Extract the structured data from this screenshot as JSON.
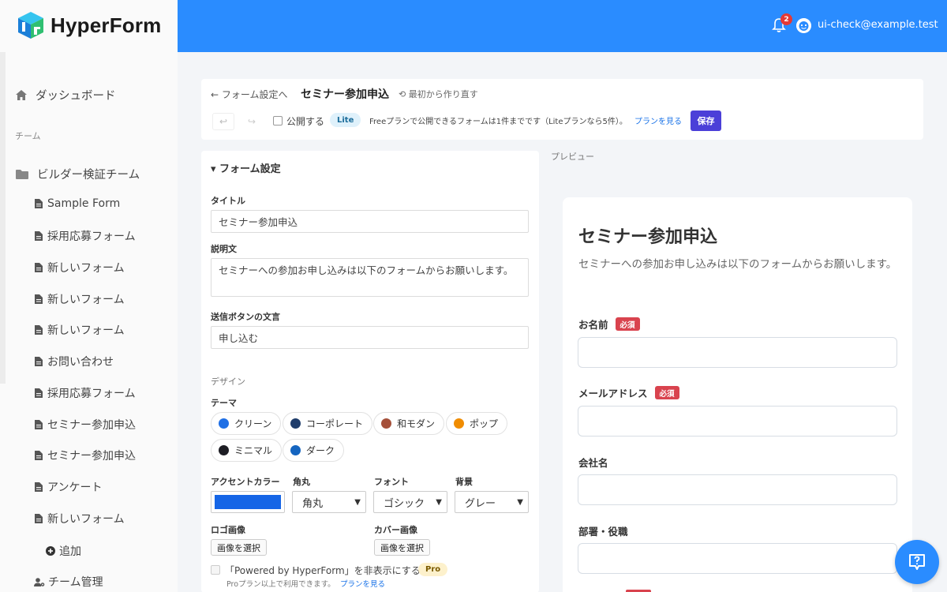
{
  "brand": {
    "name": "HyperForm"
  },
  "header": {
    "notification_count": "2",
    "user_email": "ui-check@example.test"
  },
  "sidebar": {
    "dashboard": "ダッシュボード",
    "team_section": "チーム",
    "team_name": "ビルダー検証チーム",
    "forms": [
      "Sample Form",
      "採用応募フォーム",
      "新しいフォーム",
      "新しいフォーム",
      "新しいフォーム",
      "お問い合わせ",
      "採用応募フォーム",
      "セミナー参加申込",
      "セミナー参加申込",
      "アンケート",
      "新しいフォーム"
    ],
    "add": "追加",
    "team_manage": "チーム管理"
  },
  "toolbar": {
    "back": "← フォーム設定へ",
    "title": "セミナー参加申込",
    "restart": "⟲ 最初から作り直す",
    "undo": "↩",
    "redo": "↪",
    "publish_label": "公開する",
    "plan_badge": "Lite",
    "plan_note": "Freeプランで公開できるフォームは1件までです（Liteプランなら5件）。",
    "plan_link": "プランを見る",
    "save": "保存"
  },
  "settings": {
    "heading": "▾ フォーム設定",
    "title_label": "タイトル",
    "title_value": "セミナー参加申込",
    "desc_label": "説明文",
    "desc_value": "セミナーへの参加お申し込みは以下のフォームからお願いします。",
    "submit_label": "送信ボタンの文言",
    "submit_value": "申し込む",
    "design_label": "デザイン",
    "theme_label": "テーマ",
    "themes": [
      {
        "name": "クリーン",
        "color": "#1f6fe5"
      },
      {
        "name": "コーポレート",
        "color": "#1f3d6b"
      },
      {
        "name": "和モダン",
        "color": "#a5503a"
      },
      {
        "name": "ポップ",
        "color": "#f08c00"
      },
      {
        "name": "ミニマル",
        "color": "#1d1d24"
      },
      {
        "name": "ダーク",
        "color": "#1565c0"
      }
    ],
    "accent_label": "アクセントカラー",
    "accent_color": "#1565e6",
    "radius_label": "角丸",
    "radius_value": "角丸",
    "font_label": "フォント",
    "font_value": "ゴシック",
    "bg_label": "背景",
    "bg_value": "グレー",
    "logo_label": "ロゴ画像",
    "logo_button": "画像を選択",
    "cover_label": "カバー画像",
    "cover_button": "画像を選択",
    "powered_label": "「Powered by HyperForm」を非表示にする",
    "pro_badge": "Pro",
    "pro_note": "Proプラン以上で利用できます。",
    "pro_link": "プランを見る"
  },
  "preview": {
    "label": "プレビュー",
    "title": "セミナー参加申込",
    "description": "セミナーへの参加お申し込みは以下のフォームからお願いします。",
    "required": "必須",
    "fields": [
      "お名前",
      "メールアドレス",
      "会社名",
      "部署・役職"
    ]
  }
}
